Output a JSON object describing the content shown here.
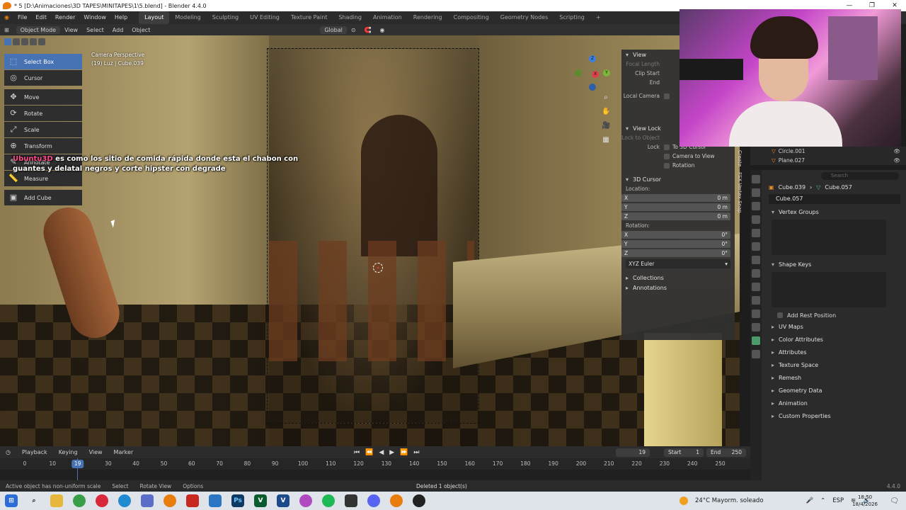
{
  "window": {
    "title": "* 5 [D:\\Animaciones\\3D TAPES\\MINITAPES\\1\\5.blend] - Blender 4.4.0",
    "minimize": "—",
    "maximize": "❐",
    "close": "✕"
  },
  "menu": {
    "items": [
      "File",
      "Edit",
      "Render",
      "Window",
      "Help"
    ],
    "workspaces": [
      "Layout",
      "Modeling",
      "Sculpting",
      "UV Editing",
      "Texture Paint",
      "Shading",
      "Animation",
      "Rendering",
      "Compositing",
      "Geometry Nodes",
      "Scripting"
    ],
    "active_workspace": "Layout",
    "add_workspace": "+"
  },
  "header": {
    "mode": "Object Mode",
    "view": "View",
    "select": "Select",
    "add": "Add",
    "object": "Object",
    "orientation": "Global"
  },
  "viewport": {
    "info_line1": "Camera Perspective",
    "info_line2": "(19) Luz | Cube.039",
    "caption_user": "Ubuntu3D",
    "caption_text": "es como los sitio de comida rápida donde esta el chabon con guantes y delatal negros y corte hipster con degrade"
  },
  "toolbar": {
    "tools": [
      {
        "label": "Select Box",
        "icon": "select-box-icon",
        "glyph": "⬚",
        "active": true
      },
      {
        "label": "Cursor",
        "icon": "cursor-icon",
        "glyph": "◎",
        "active": false
      },
      {
        "label": "Move",
        "icon": "move-icon",
        "glyph": "✥",
        "active": false
      },
      {
        "label": "Rotate",
        "icon": "rotate-icon",
        "glyph": "⟳",
        "active": false
      },
      {
        "label": "Scale",
        "icon": "scale-icon",
        "glyph": "⤢",
        "active": false
      },
      {
        "label": "Transform",
        "icon": "transform-icon",
        "glyph": "⊕",
        "active": false
      },
      {
        "label": "Annotate",
        "icon": "annotate-icon",
        "glyph": "✎",
        "active": false
      },
      {
        "label": "Measure",
        "icon": "measure-icon",
        "glyph": "📏",
        "active": false
      },
      {
        "label": "Add Cube",
        "icon": "add-cube-icon",
        "glyph": "▣",
        "active": false
      }
    ]
  },
  "npanel": {
    "view_label": "View",
    "focal_length": "Focal Length",
    "clip_start": "Clip Start",
    "clip_end": "End",
    "local_camera": "Local Camera",
    "view_lock": "View Lock",
    "lock_to_object": "Lock to Object",
    "lock": "Lock",
    "to_3d_cursor": "To 3D Cursor",
    "camera_to_view": "Camera to View",
    "rotation_chk": "Rotation",
    "cursor_3d": "3D Cursor",
    "location": "Location:",
    "loc_x": "X",
    "loc_x_val": "0 m",
    "loc_y": "Y",
    "loc_y_val": "0 m",
    "loc_z": "Z",
    "loc_z_val": "0 m",
    "rotation": "Rotation:",
    "rot_x": "X",
    "rot_x_val": "0°",
    "rot_y": "Y",
    "rot_y_val": "0°",
    "rot_z": "Z",
    "rot_z_val": "0°",
    "euler": "XYZ Euler",
    "collections": "Collections",
    "annotations": "Annotations",
    "tabs": [
      "Create",
      "FSX Vertex Snap"
    ]
  },
  "outliner": {
    "items": [
      "Circle.001",
      "Plane.027"
    ]
  },
  "properties": {
    "search_placeholder": "Search",
    "object_name": "Cube.039",
    "mesh_name": "Cube.057",
    "mesh_field": "Cube.057",
    "vertex_groups": "Vertex Groups",
    "shape_keys": "Shape Keys",
    "add_rest_position": "Add Rest Position",
    "sections": [
      "UV Maps",
      "Color Attributes",
      "Attributes",
      "Texture Space",
      "Remesh",
      "Geometry Data",
      "Animation",
      "Custom Properties"
    ]
  },
  "timeline": {
    "playback": "Playback",
    "keying": "Keying",
    "view": "View",
    "marker": "Marker",
    "current_frame": "19",
    "start_label": "Start",
    "start": "1",
    "end_label": "End",
    "end": "250",
    "ticks": [
      "0",
      "10",
      "30",
      "40",
      "50",
      "60",
      "70",
      "80",
      "90",
      "100",
      "110",
      "120",
      "130",
      "140",
      "150",
      "160",
      "170",
      "180",
      "190",
      "200",
      "210",
      "220",
      "230",
      "240",
      "250"
    ],
    "playhead": "19"
  },
  "status": {
    "warning": "Active object has non-uniform scale",
    "select": "Select",
    "rotate_view": "Rotate View",
    "options": "Options",
    "notice": "Deleted 1 object(s)",
    "version": "4.4.0"
  },
  "taskbar": {
    "weather": "24°C  Mayorm. soleado",
    "lang": "ESP",
    "time": "18:50",
    "date": "18/4/2026"
  }
}
